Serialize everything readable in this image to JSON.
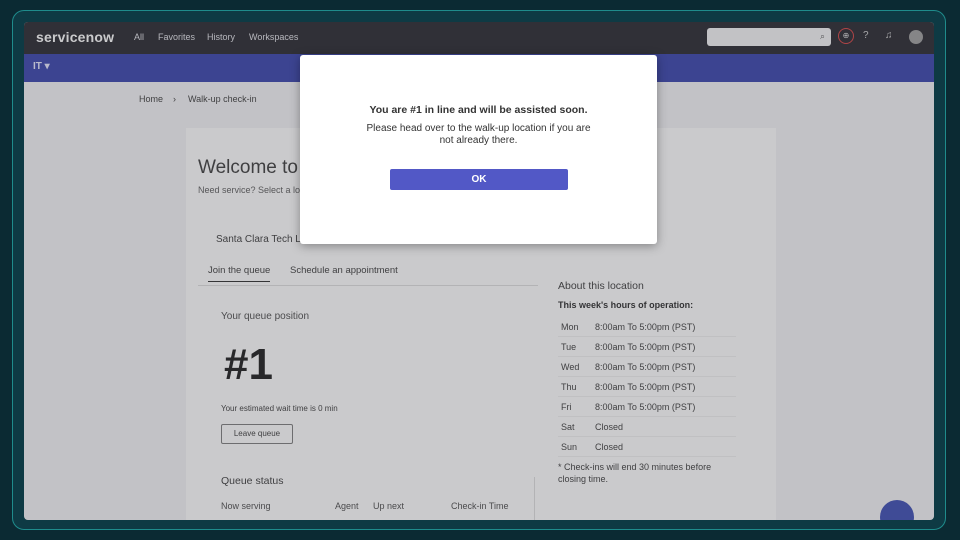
{
  "header": {
    "logo": "servicenow",
    "nav": [
      "All",
      "Favorites",
      "History",
      "Workspaces"
    ],
    "search_icon": "search-icon"
  },
  "subbar": {
    "scope": "IT ▾"
  },
  "breadcrumb": {
    "home": "Home",
    "separator": "›",
    "current": "Walk-up check-in"
  },
  "page": {
    "title": "Welcome to W",
    "subtitle": "Need service? Select a lo",
    "location": "Santa Clara Tech L",
    "tabs": [
      "Join the queue",
      "Schedule an appointment"
    ],
    "queue": {
      "title": "Your queue position",
      "position": "#1",
      "wait": "Your estimated wait time is 0 min",
      "leave_label": "Leave queue"
    },
    "queue_status": {
      "title": "Queue status",
      "columns": [
        "Now serving",
        "Agent",
        "Up next",
        "Check-in Time"
      ]
    }
  },
  "about": {
    "title": "About this location",
    "hours_label": "This week's hours of operation:",
    "hours": [
      {
        "day": "Mon",
        "time": "8:00am To 5:00pm (PST)"
      },
      {
        "day": "Tue",
        "time": "8:00am To 5:00pm (PST)"
      },
      {
        "day": "Wed",
        "time": "8:00am To 5:00pm (PST)"
      },
      {
        "day": "Thu",
        "time": "8:00am To 5:00pm (PST)"
      },
      {
        "day": "Fri",
        "time": "8:00am To 5:00pm (PST)"
      },
      {
        "day": "Sat",
        "time": "Closed"
      },
      {
        "day": "Sun",
        "time": "Closed"
      }
    ],
    "note": "* Check-ins will end 30 minutes before closing time."
  },
  "modal": {
    "message1": "You are #1 in line and will be assisted soon.",
    "message2": "Please head over to the walk-up location if you are not already there.",
    "ok_label": "OK"
  },
  "colors": {
    "nav_bg": "#1c1d24",
    "subbar_bg": "#2f3aa8",
    "button": "#5258c6"
  }
}
